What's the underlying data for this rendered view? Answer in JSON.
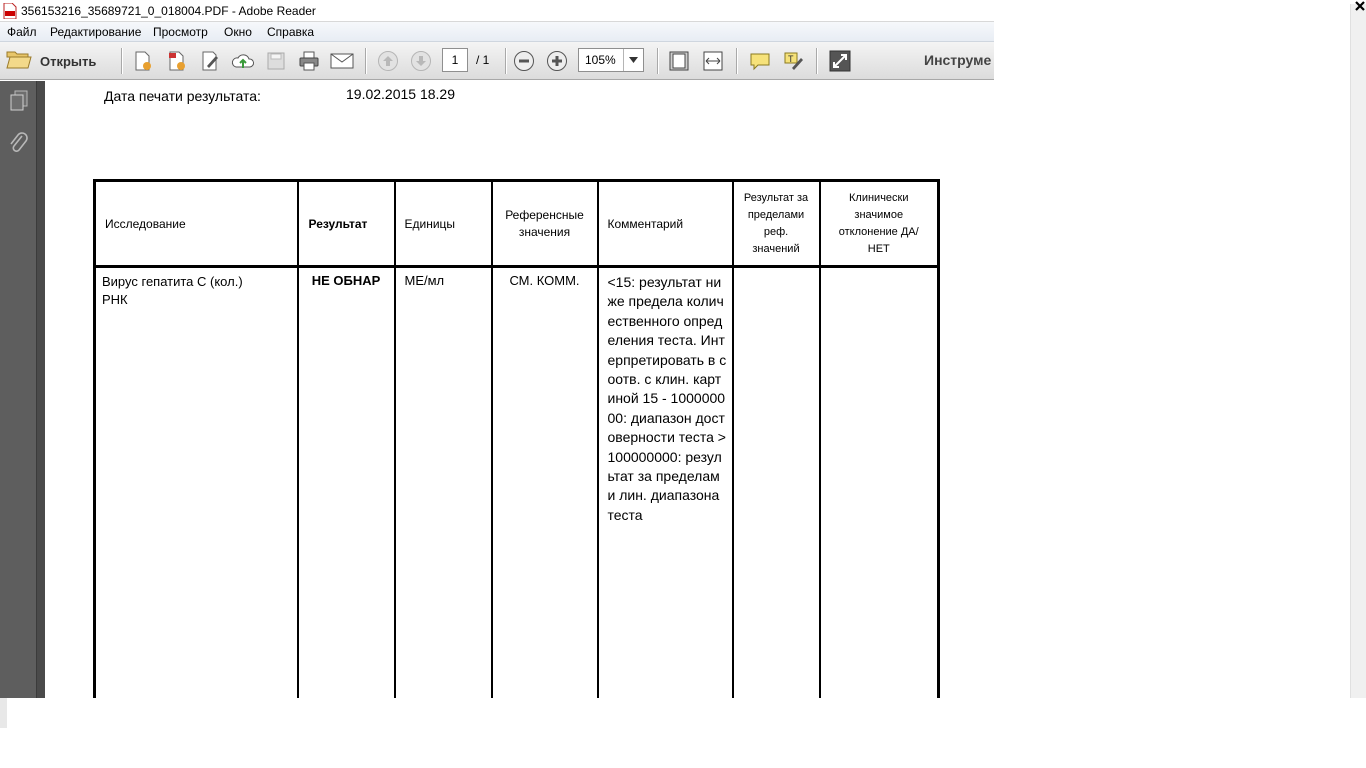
{
  "window": {
    "title": "356153216_35689721_0_018004.PDF - Adobe Reader"
  },
  "menu": {
    "items": [
      "Файл",
      "Редактирование",
      "Просмотр",
      "Окно",
      "Справка"
    ]
  },
  "toolbar": {
    "open_label": "Открыть",
    "page_current": "1",
    "page_total": "/ 1",
    "zoom": "105%",
    "tools_label": "Инструме"
  },
  "document": {
    "print_date_label": "Дата печати результата:",
    "print_date_value": "19.02.2015 18.29",
    "table": {
      "headers": [
        "Исследование",
        "Результат",
        "Единицы",
        "Референсные значения",
        "Комментарий",
        "Результат за пределами реф. значений",
        "Клинически значимое отклонение ДА/НЕТ"
      ],
      "rows": [
        {
          "study_line1": "Вирус гепатита С (кол.)",
          "study_line2": "РНК",
          "result": "НЕ ОБНАР",
          "units": "МЕ/мл",
          "reference": "СМ. КОММ.",
          "comment": "<15: результат ниже предела количественного определения теста. Интерпретировать в соотв. с клин. картиной 15 - 100000000: диапазон достоверности теста >100000000: результат за пределами лин. диапазона теста",
          "out_of_range": "",
          "clinically_significant": ""
        }
      ]
    }
  },
  "colors": {
    "nav_panel": "#4a4a4a",
    "toolbar_bg": "#e4e4e4",
    "menubar_bg": "#eef2f7"
  }
}
